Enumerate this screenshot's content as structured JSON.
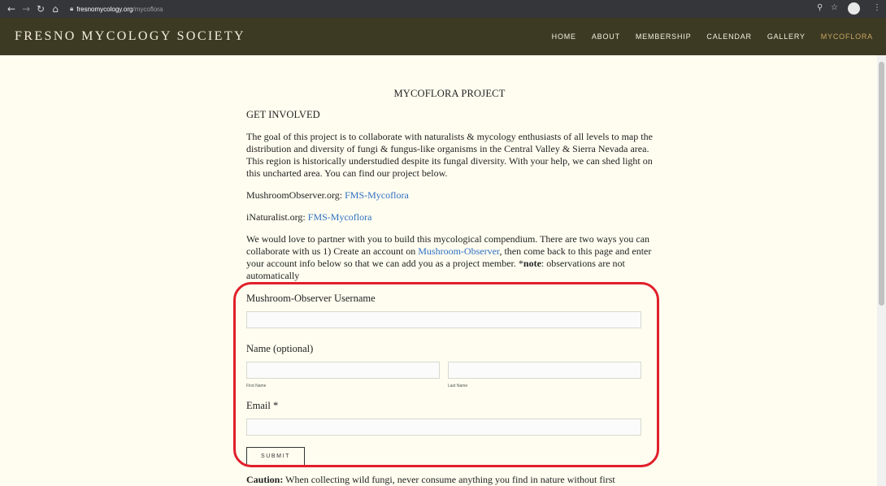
{
  "browser": {
    "url_host": "fresnomycology.org",
    "url_path": "/mycoflora",
    "back_icon": "arrow-left-icon",
    "forward_icon": "arrow-right-icon",
    "reload_icon": "reload-icon",
    "home_icon": "home-icon",
    "lock_icon": "lock-icon",
    "zoom_icon": "magnifier-icon",
    "star_icon": "star-icon",
    "menu_icon": "kebab-menu-icon"
  },
  "site": {
    "title": "FRESNO MYCOLOGY SOCIETY",
    "nav": [
      {
        "label": "HOME"
      },
      {
        "label": "ABOUT"
      },
      {
        "label": "MEMBERSHIP"
      },
      {
        "label": "CALENDAR"
      },
      {
        "label": "GALLERY"
      },
      {
        "label": "MYCOFLORA",
        "active": true
      }
    ],
    "colors": {
      "header_bg": "#3d3a24",
      "page_bg": "#fefdf0",
      "active_nav": "#c8a760",
      "link": "#2f6fc1",
      "highlight": "#e11f2b"
    }
  },
  "main": {
    "heading": "MYCOFLORA PROJECT",
    "subheading": "GET INVOLVED",
    "intro": "The goal of this project is to collaborate with naturalists & mycology enthusiasts of all levels to map the distribution and diversity of fungi & fungus-like organisms in the Central Valley & Sierra Nevada area. This region is historically understudied despite its fungal diversity. With your help, we can shed light on this uncharted area. You can find our project below.",
    "mo_prefix": "MushroomObserver.org:",
    "mo_link": "FMS-Mycoflora",
    "inat_prefix": "iNaturalist.org:",
    "inat_link": "FMS-Mycoflora",
    "partner_text_1": "We would love to partner with you to build this mycological compendium. There are two ways you can collaborate with us 1) Create an account on",
    "partner_link": "Mushroom-Observer",
    "partner_text_2": ", then come back to this page and enter your account info below so that we can add you as a project member. *",
    "partner_note_bold": "note",
    "partner_text_3": ": observations are not automatically"
  },
  "form": {
    "username_label": "Mushroom-Observer Username",
    "username_value": "",
    "name_label": "Name (optional)",
    "first_name_value": "",
    "first_name_sublabel": "First Name",
    "last_name_value": "",
    "last_name_sublabel": "Last Name",
    "email_label": "Email *",
    "email_value": "",
    "submit_label": "SUBMIT"
  },
  "caution": {
    "bold": "Caution:",
    "text": " When collecting wild fungi, never consume anything you find in nature without first"
  }
}
